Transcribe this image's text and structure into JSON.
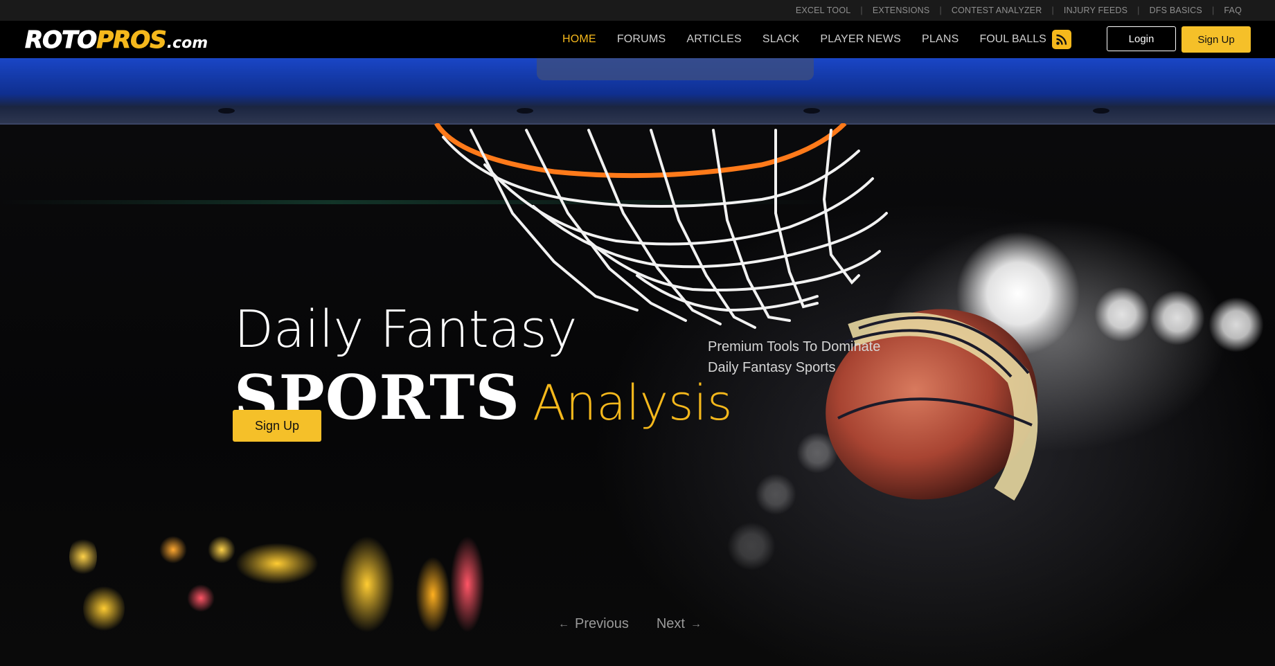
{
  "topbar": {
    "links": [
      "EXCEL TOOL",
      "EXTENSIONS",
      "CONTEST ANALYZER",
      "INJURY FEEDS",
      "DFS BASICS",
      "FAQ"
    ],
    "separator": "|"
  },
  "logo": {
    "part1": "ROTO",
    "part2": "PROS",
    "part3": ".com"
  },
  "nav": {
    "items": [
      {
        "label": "HOME",
        "active": true
      },
      {
        "label": "FORUMS",
        "active": false
      },
      {
        "label": "ARTICLES",
        "active": false
      },
      {
        "label": "SLACK",
        "active": false
      },
      {
        "label": "PLAYER NEWS",
        "active": false
      },
      {
        "label": "PLANS",
        "active": false
      }
    ],
    "foul_balls_label": "FOUL BALLS",
    "foul_balls_icon": "rss-icon",
    "login_label": "Login",
    "signup_label": "Sign Up"
  },
  "hero": {
    "line1": "Daily Fantasy",
    "sports": "SPORTS",
    "analysis": "Analysis",
    "tagline_line1": "Premium Tools To Dominate",
    "tagline_line2": "Daily Fantasy Sports",
    "signup_label": "Sign Up",
    "previous_label": "Previous",
    "next_label": "Next",
    "previous_icon": "arrow-left-icon",
    "next_icon": "arrow-right-icon"
  },
  "colors": {
    "accent": "#f5b81c",
    "button": "#f5c029",
    "backboard": "#1a46c6",
    "background": "#000000"
  }
}
